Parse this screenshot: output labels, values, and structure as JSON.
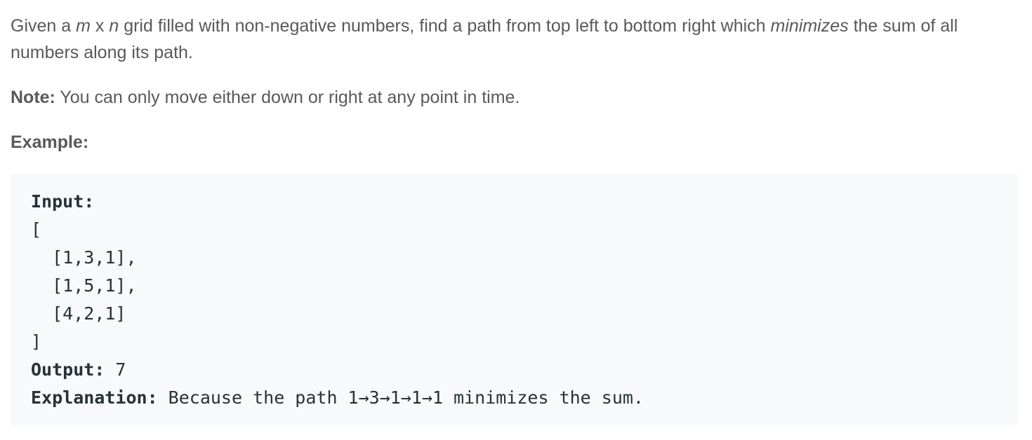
{
  "problem": {
    "desc_part1": "Given a ",
    "m": "m",
    "desc_x": " x ",
    "n": "n",
    "desc_part2": " grid filled with non-negative numbers, find a path from top left to bottom right which ",
    "minimizes": "minimizes",
    "desc_part3": " the sum of all numbers along its path.",
    "note_label": "Note:",
    "note_text": " You can only move either down or right at any point in time.",
    "example_label": "Example:"
  },
  "example": {
    "input_label": "Input:",
    "open_bracket": "[",
    "rows": [
      "  [1,3,1],",
      "  [1,5,1],",
      "  [4,2,1]"
    ],
    "close_bracket": "]",
    "output_label": "Output:",
    "output_value": " 7",
    "explanation_label": "Explanation:",
    "explanation_text": " Because the path 1→3→1→1→1 minimizes the sum."
  }
}
